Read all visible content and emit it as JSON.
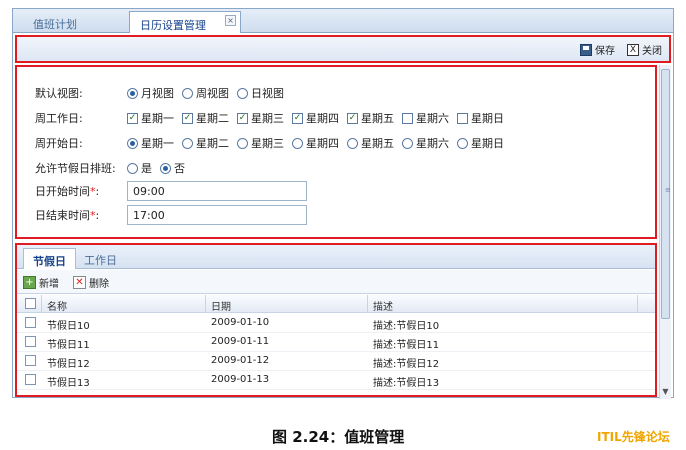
{
  "tabs": [
    {
      "label": "值班计划"
    },
    {
      "label": "日历设置管理",
      "close": "×"
    }
  ],
  "toolbar": {
    "save_label": "保存",
    "close_label": "关闭",
    "close_glyph": "X"
  },
  "form": {
    "default_view": {
      "label": "默认视图:",
      "options": [
        "月视图",
        "周视图",
        "日视图"
      ],
      "selected": "月视图"
    },
    "work_days": {
      "label": "周工作日:",
      "options": [
        "星期一",
        "星期二",
        "星期三",
        "星期四",
        "星期五",
        "星期六",
        "星期日"
      ],
      "checked": [
        true,
        true,
        true,
        true,
        true,
        false,
        false
      ]
    },
    "week_start": {
      "label": "周开始日:",
      "options": [
        "星期一",
        "星期二",
        "星期三",
        "星期四",
        "星期五",
        "星期六",
        "星期日"
      ],
      "selected": "星期一"
    },
    "holiday_shift": {
      "label": "允许节假日排班:",
      "options": [
        "是",
        "否"
      ],
      "selected": "否"
    },
    "day_start": {
      "label": "日开始时间",
      "required": "*",
      "colon": ":",
      "value": "09:00"
    },
    "day_end": {
      "label": "日结束时间",
      "required": "*",
      "colon": ":",
      "value": "17:00"
    }
  },
  "grid": {
    "tabs": [
      "节假日",
      "工作日"
    ],
    "add_label": "新增",
    "delete_label": "删除",
    "columns": [
      "名称",
      "日期",
      "描述"
    ],
    "rows": [
      {
        "name": "节假日10",
        "date": "2009-01-10",
        "desc": "描述:节假日10"
      },
      {
        "name": "节假日11",
        "date": "2009-01-11",
        "desc": "描述:节假日11"
      },
      {
        "name": "节假日12",
        "date": "2009-01-12",
        "desc": "描述:节假日12"
      },
      {
        "name": "节假日13",
        "date": "2009-01-13",
        "desc": "描述:节假日13"
      }
    ]
  },
  "caption": "图 2.24：值班管理",
  "brand": "ITIL先锋论坛",
  "colors": {
    "highlight": "#e01b22",
    "brand": "#f0a500"
  }
}
